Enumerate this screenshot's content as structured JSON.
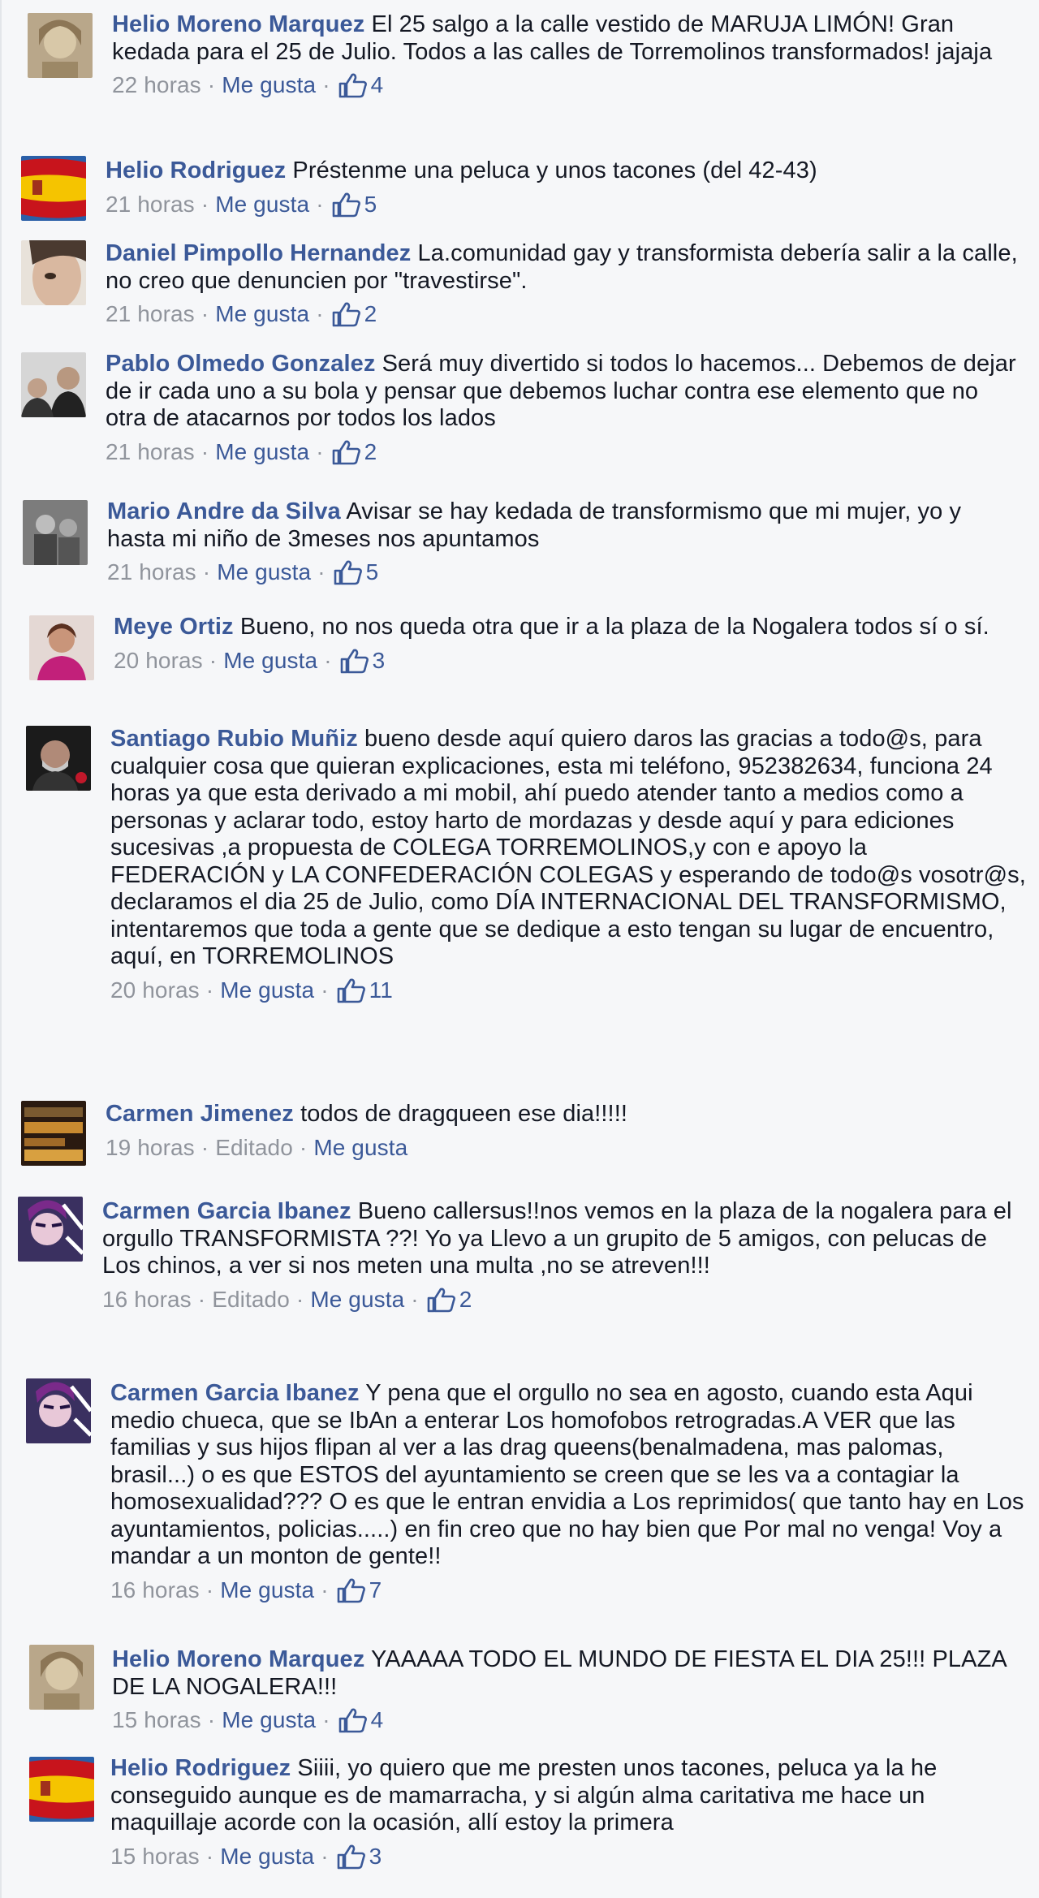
{
  "comments": [
    {
      "author": "Helio Moreno Marquez",
      "text": "El 25 salgo a la calle vestido de MARUJA LIMÓN! Gran kedada para el 25 de Julio. Todos a las calles de Torremolinos transformados! jajaja",
      "time": "22 horas",
      "like_label": "Me gusta",
      "likes": "4",
      "avatar_icon": "profile-photo"
    },
    {
      "author": "Helio Rodriguez",
      "text": "Préstenme una peluca y unos tacones (del 42-43)",
      "time": "21 horas",
      "like_label": "Me gusta",
      "likes": "5",
      "avatar_icon": "spain-flag"
    },
    {
      "author": "Daniel Pimpollo Hernandez",
      "text": "La.comunidad gay y transformista debería salir a la calle, no creo que denuncien por \"travestirse\".",
      "time": "21 horas",
      "like_label": "Me gusta",
      "likes": "2",
      "avatar_icon": "profile-photo"
    },
    {
      "author": "Pablo Olmedo Gonzalez",
      "text": "Será muy divertido si todos lo hacemos... Debemos de dejar de ir cada uno a su bola y pensar que debemos luchar contra ese elemento que no otra de atacarnos por todos los lados",
      "time": "21 horas",
      "like_label": "Me gusta",
      "likes": "2",
      "avatar_icon": "profile-photo"
    },
    {
      "author": "Mario Andre da Silva",
      "text": "Avisar se hay kedada de transformismo que mi mujer, yo y hasta mi niño de 3meses nos apuntamos",
      "time": "21 horas",
      "like_label": "Me gusta",
      "likes": "5",
      "avatar_icon": "profile-photo"
    },
    {
      "author": "Meye Ortiz",
      "text": "Bueno, no nos queda otra que ir a la plaza de la Nogalera todos sí o sí.",
      "time": "20 horas",
      "like_label": "Me gusta",
      "likes": "3",
      "avatar_icon": "profile-photo"
    },
    {
      "author": "Santiago Rubio Muñiz",
      "text": "bueno desde aquí quiero daros las gracias a todo@s, para cualquier cosa que quieran explicaciones, esta mi teléfono, 952382634, funciona 24 horas ya que esta derivado a mi mobil, ahí puedo atender tanto a medios como a personas y aclarar todo, estoy harto de mordazas y desde aquí y para ediciones sucesivas ,a propuesta de COLEGA TORREMOLINOS,y con e apoyo la FEDERACIÓN y LA CONFEDERACIÓN COLEGAS y esperando de todo@s vosotr@s, declaramos el dia 25 de Julio, como DÍA INTERNACIONAL DEL TRANSFORMISMO, intentaremos que toda a gente que se dedique a esto tengan su lugar de encuentro, aquí, en TORREMOLINOS",
      "time": "20 horas",
      "like_label": "Me gusta",
      "likes": "11",
      "avatar_icon": "profile-photo"
    },
    {
      "author": "Carmen Jimenez",
      "text": "todos de dragqueen ese dia!!!!!",
      "time": "19 horas",
      "edited": "Editado",
      "like_label": "Me gusta",
      "likes": "",
      "avatar_icon": "poster-image"
    },
    {
      "author": "Carmen Garcia Ibanez",
      "text": "Bueno callersus!!nos vemos en la plaza de la nogalera para el orgullo TRANSFORMISTA ??! Yo ya Llevo a un grupito de 5 amigos, con pelucas de Los chinos, a ver si nos meten una multa ,no se atreven!!!",
      "time": "16 horas",
      "edited": "Editado",
      "like_label": "Me gusta",
      "likes": "2",
      "avatar_icon": "profile-photo"
    },
    {
      "author": "Carmen Garcia Ibanez",
      "text": "Y pena que el orgullo no sea en agosto, cuando esta Aqui medio chueca, que se IbAn a enterar Los homofobos retrogradas.A VER que las familias y sus hijos flipan al ver a las drag queens(benalmadena, mas palomas, brasil...) o es que ESTOS del ayuntamiento se creen que se les va a contagiar la homosexualidad??? O es que le entran envidia a Los reprimidos( que tanto hay en Los ayuntamientos, policias.....) en fin creo que no hay bien que Por mal no venga! Voy a mandar a un monton de gente!!",
      "time": "16 horas",
      "like_label": "Me gusta",
      "likes": "7",
      "avatar_icon": "profile-photo"
    },
    {
      "author": "Helio Moreno Marquez",
      "text": "YAAAAA TODO EL MUNDO DE FIESTA EL DIA 25!!! PLAZA DE LA NOGALERA!!!",
      "time": "15 horas",
      "like_label": "Me gusta",
      "likes": "4",
      "avatar_icon": "profile-photo"
    },
    {
      "author": "Helio Rodriguez",
      "text": "Siiii, yo quiero que me presten unos tacones, peluca ya la he conseguido aunque es de mamarracha, y si algún alma caritativa me hace un maquillaje acorde con la ocasión, allí estoy la primera",
      "time": "15 horas",
      "like_label": "Me gusta",
      "likes": "3",
      "avatar_icon": "spain-flag"
    }
  ],
  "colors": {
    "link": "#3b5998",
    "meta": "#90949c",
    "text": "#141823",
    "background": "#f6f7f9"
  }
}
